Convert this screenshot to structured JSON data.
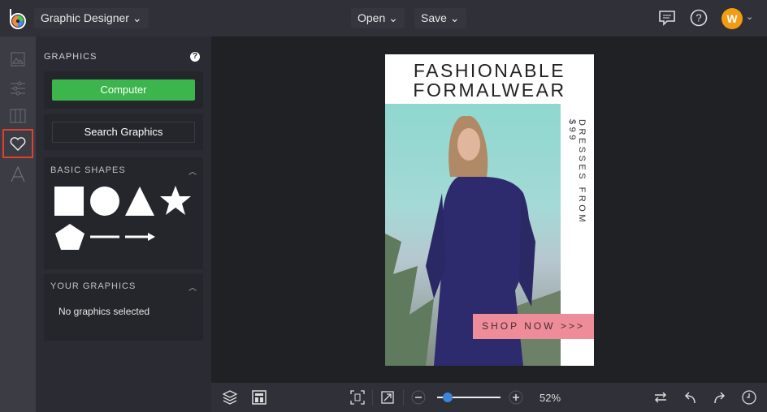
{
  "topbar": {
    "app_menu": "Graphic Designer",
    "open": "Open",
    "save": "Save",
    "avatar_initial": "W"
  },
  "panel": {
    "title": "GRAPHICS",
    "help": "?",
    "computer": "Computer",
    "search": "Search Graphics",
    "basic_shapes": "BASIC SHAPES",
    "your_graphics": "YOUR GRAPHICS",
    "no_graphics": "No graphics selected"
  },
  "poster": {
    "title_line1": "FASHIONABLE",
    "title_line2": "FORMALWEAR",
    "vertical": "DRESSES FROM $99",
    "shop": "SHOP NOW >>>"
  },
  "bottom": {
    "zoom": "52%",
    "zoom_value": 52
  },
  "colors": {
    "accent": "#3cb64c",
    "selected": "#e0402f",
    "slider": "#3d85d8",
    "cta": "#ee8c9a"
  }
}
